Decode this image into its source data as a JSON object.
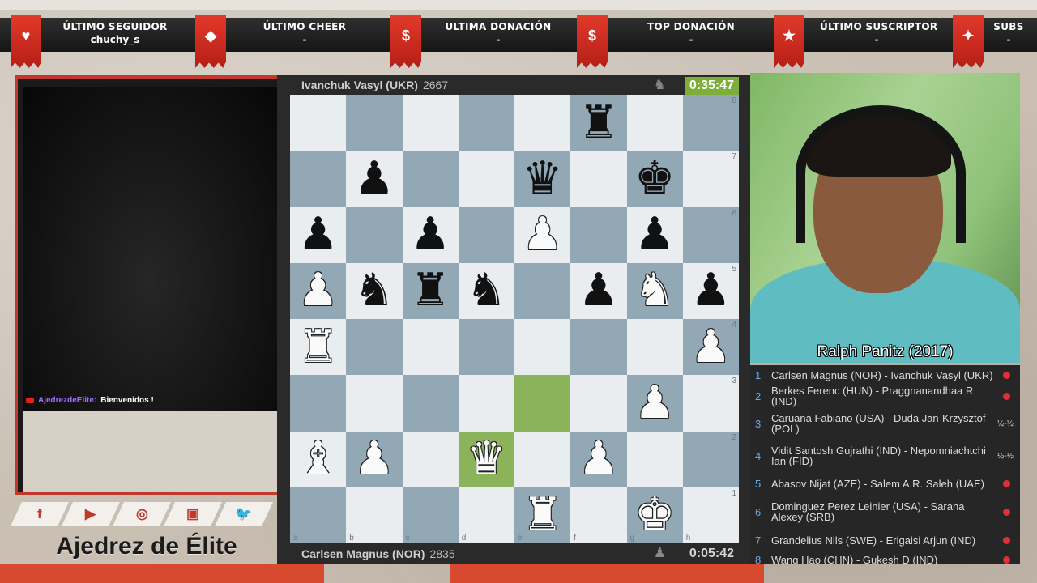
{
  "alerts": {
    "items": [
      {
        "label": "ÚLTIMO SEGUIDOR",
        "value": "chuchy_s",
        "icon": "heart-icon"
      },
      {
        "label": "ÚLTIMO CHEER",
        "value": "-",
        "icon": "gem-icon"
      },
      {
        "label": "ULTIMA DONACIÓN",
        "value": "-",
        "icon": "dollar-icon"
      },
      {
        "label": "TOP DONACIÓN",
        "value": "-",
        "icon": "money-bag-icon"
      },
      {
        "label": "ÚLTIMO SUSCRIPTOR",
        "value": "-",
        "icon": "star-icon"
      },
      {
        "label": "SUBS",
        "value": "-",
        "icon": "stars-icon"
      }
    ],
    "icon_glyphs": [
      "♥",
      "◆",
      "$",
      "$",
      "★",
      "✦"
    ],
    "accent_color": "#d8322a"
  },
  "chat": {
    "platform_icon": "youtube-icon",
    "user": "AjedrezdeElite:",
    "message": "Bienvenidos !"
  },
  "social": {
    "icons": [
      "facebook-icon",
      "youtube-icon",
      "instagram-icon",
      "twitch-icon",
      "twitter-icon"
    ],
    "glyphs": [
      "f",
      "▶",
      "◎",
      "▣",
      "🐦"
    ]
  },
  "brand": {
    "name": "Ajedrez de Élite"
  },
  "chess": {
    "top_player": {
      "name": "Ivanchuk Vasyl (UKR)",
      "rating": "2667",
      "clock": "0:35:47",
      "clock_active": true
    },
    "bottom_player": {
      "name": "Carlsen Magnus (NOR)",
      "rating": "2835",
      "clock": "0:05:42",
      "clock_active": false
    },
    "files": [
      "a",
      "b",
      "c",
      "d",
      "e",
      "f",
      "g",
      "h"
    ],
    "ranks": [
      "8",
      "7",
      "6",
      "5",
      "4",
      "3",
      "2",
      "1"
    ],
    "highlighted": [
      "e3",
      "d2"
    ],
    "pieces": {
      "f8": "bR",
      "e7": "bQ",
      "g7": "bK",
      "b7": "bP",
      "a6": "bP",
      "c6": "bP",
      "e6": "wP",
      "g6": "bP",
      "a5": "wP",
      "b5": "bN",
      "c5": "bR",
      "d5": "bN",
      "f5": "bP",
      "g5": "wN",
      "h5": "bP",
      "a4": "wR",
      "h4": "wP",
      "g3": "wP",
      "a2": "wB",
      "b2": "wP",
      "d2": "wQ",
      "f2": "wP",
      "e1": "wR",
      "g1": "wK"
    },
    "board_colors": {
      "light": "#e9edef",
      "dark": "#92a9b5",
      "highlight": "#8bb35a"
    }
  },
  "webcam": {
    "streamer_name": "Ralph Panitz (2017)"
  },
  "games": [
    {
      "num": "1",
      "pair": "Carlsen Magnus (NOR) - Ivanchuk Vasyl (UKR)",
      "result": "",
      "live": true
    },
    {
      "num": "2",
      "pair": "Berkes Ferenc (HUN) - Praggnanandhaa R (IND)",
      "result": "",
      "live": true
    },
    {
      "num": "3",
      "pair": "Caruana Fabiano (USA) - Duda Jan-Krzysztof (POL)",
      "result": "½-½",
      "live": false
    },
    {
      "num": "4",
      "pair": "Vidit Santosh Gujrathi (IND) - Nepomniachtchi Ian (FID)",
      "result": "½-½",
      "live": false
    },
    {
      "num": "5",
      "pair": "Abasov Nijat (AZE) - Salem A.R. Saleh (UAE)",
      "result": "",
      "live": true
    },
    {
      "num": "6",
      "pair": "Dominguez Perez Leinier (USA) - Sarana Alexey (SRB)",
      "result": "",
      "live": true
    },
    {
      "num": "7",
      "pair": "Grandelius Nils (SWE) - Erigaisi Arjun (IND)",
      "result": "",
      "live": true
    },
    {
      "num": "8",
      "pair": "Wang Hao (CHN) - Gukesh D (IND)",
      "result": "",
      "live": true
    }
  ]
}
